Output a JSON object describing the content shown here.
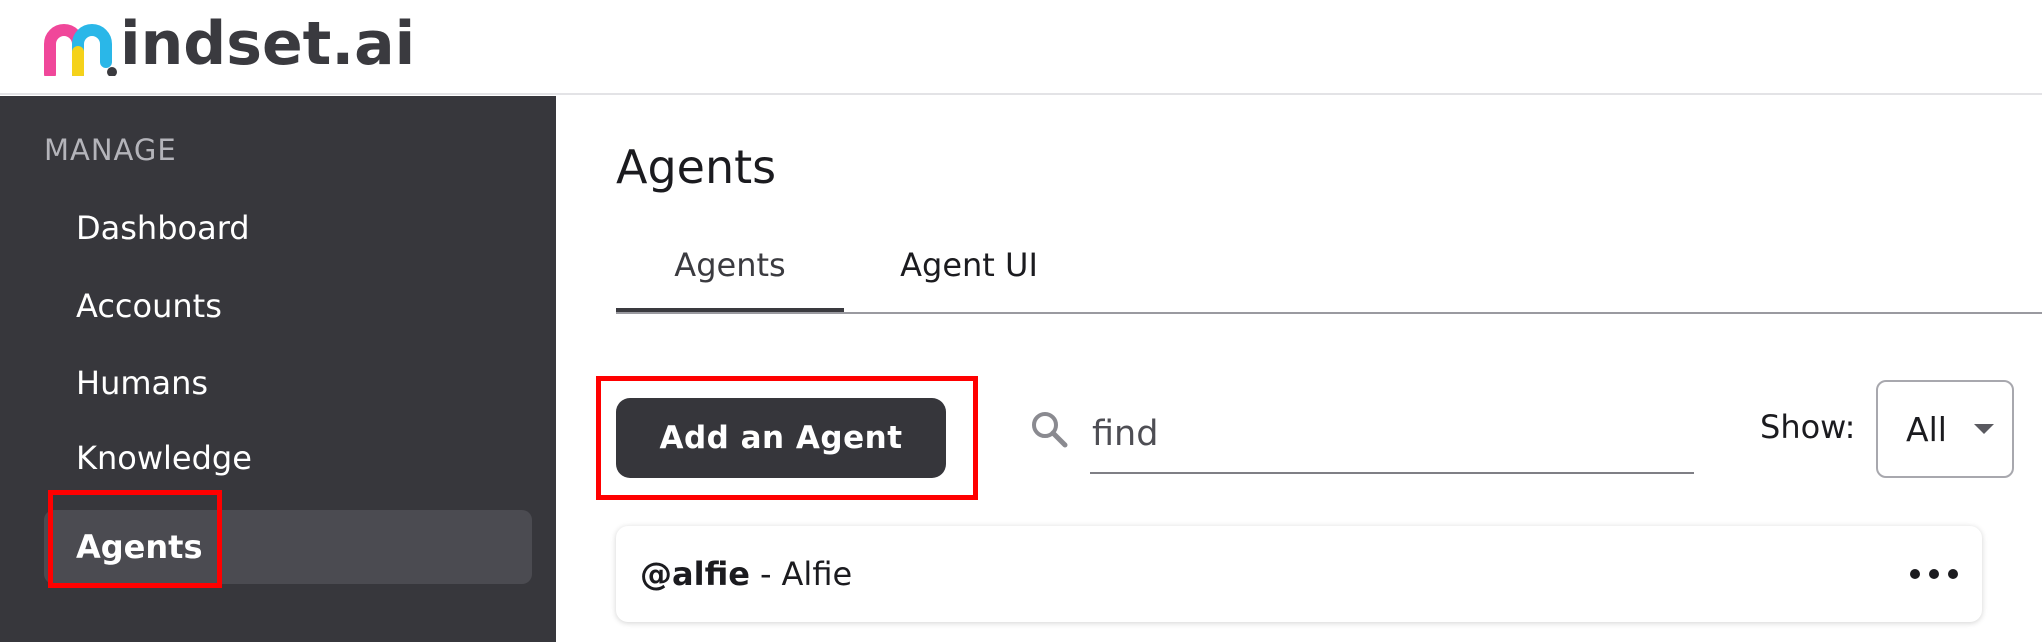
{
  "logo": {
    "first_letter_icon": "m-gradient-icon",
    "text": "indset.ai"
  },
  "sidebar": {
    "section_label": "MANAGE",
    "items": [
      {
        "label": "Dashboard",
        "active": false
      },
      {
        "label": "Accounts",
        "active": false
      },
      {
        "label": "Humans",
        "active": false
      },
      {
        "label": "Knowledge",
        "active": false
      },
      {
        "label": "Agents",
        "active": true
      }
    ]
  },
  "main": {
    "title": "Agents",
    "tabs": [
      {
        "label": "Agents",
        "active": true
      },
      {
        "label": "Agent UI",
        "active": false
      }
    ],
    "add_button_label": "Add an Agent",
    "search": {
      "placeholder": "find",
      "value": "",
      "icon": "search-icon"
    },
    "filter": {
      "label": "Show:",
      "selected": "All"
    },
    "agents": [
      {
        "handle": "@alfie",
        "separator": "-",
        "name": "Alfie",
        "menu_icon": "more-horizontal-icon"
      }
    ]
  },
  "colors": {
    "sidebar_bg": "#37373c",
    "active_item_bg": "#4b4b51",
    "button_bg": "#36363b",
    "highlight_box": "#ff0000",
    "logo_pink": "#f0479a",
    "logo_yellow": "#f5d21a",
    "logo_cyan": "#2ab7e8"
  }
}
